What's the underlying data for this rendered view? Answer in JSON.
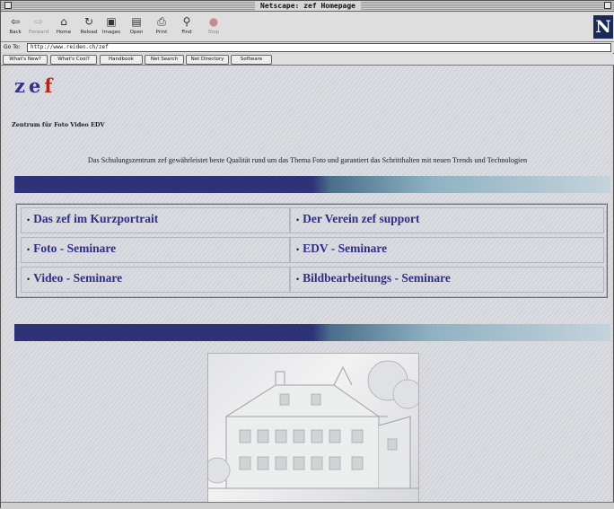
{
  "window": {
    "title": "Netscape: zef Homepage"
  },
  "toolbar": {
    "buttons": [
      {
        "label": "Back",
        "icon": "back-arrow-icon",
        "glyph": "⇦"
      },
      {
        "label": "Forward",
        "icon": "forward-arrow-icon",
        "glyph": "⇨"
      },
      {
        "label": "Home",
        "icon": "home-icon",
        "glyph": "⌂"
      },
      {
        "label": "Reload",
        "icon": "reload-icon",
        "glyph": "↻"
      },
      {
        "label": "Images",
        "icon": "images-icon",
        "glyph": "▣"
      },
      {
        "label": "Open",
        "icon": "open-icon",
        "glyph": "▤"
      },
      {
        "label": "Print",
        "icon": "print-icon",
        "glyph": "⎙"
      },
      {
        "label": "Find",
        "icon": "find-icon",
        "glyph": "⚲"
      },
      {
        "label": "Stop",
        "icon": "stop-icon",
        "glyph": "●"
      }
    ],
    "brand": "N"
  },
  "location": {
    "label": "Go To:",
    "url": "http://www.reiden.ch/zef"
  },
  "directory": {
    "buttons": [
      "What's New?",
      "What's Cool?",
      "Handbook",
      "Net Search",
      "Net Directory",
      "Software"
    ]
  },
  "page": {
    "logo": {
      "z": "z",
      "e": "e",
      "f": "f"
    },
    "tagline": "Zentrum für Foto Video EDV",
    "description": "Das Schulungszentrum zef gewährleistet beste Qualität rund um das Thema Foto und garantiert das Schritthalten mit neuen Trends und Technologien",
    "bullet": "•",
    "links": [
      "Das zef im Kurzportrait",
      "Der Verein zef support",
      "Foto - Seminare",
      "EDV - Seminare",
      "Video - Seminare",
      "Bildbearbeitungs - Seminare"
    ]
  },
  "colors": {
    "accent": "#2e2f86",
    "bar_dark": "#2e3378",
    "bar_light": "#8fb2c2",
    "logo_f": "#b2261a"
  }
}
